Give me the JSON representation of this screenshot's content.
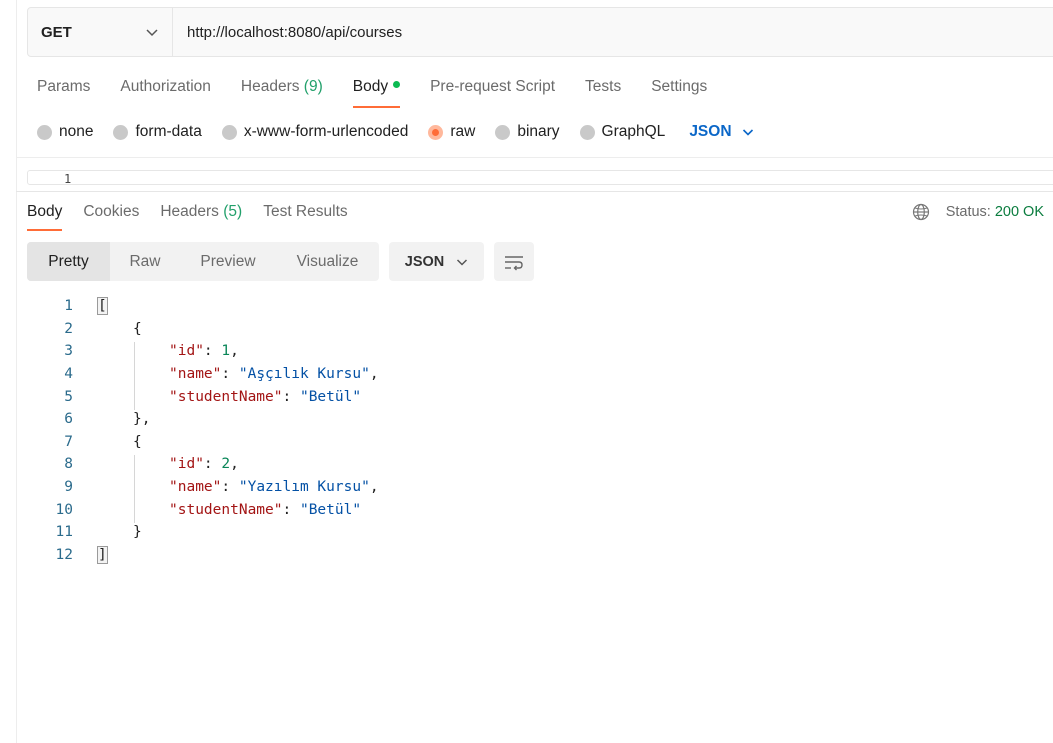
{
  "request": {
    "method": "GET",
    "url": "http://localhost:8080/api/courses"
  },
  "request_tabs": [
    {
      "label": "Params"
    },
    {
      "label": "Authorization"
    },
    {
      "label": "Headers",
      "count": "(9)"
    },
    {
      "label": "Body",
      "active": true
    },
    {
      "label": "Pre-request Script"
    },
    {
      "label": "Tests"
    },
    {
      "label": "Settings"
    }
  ],
  "body_types": [
    "none",
    "form-data",
    "x-www-form-urlencoded",
    "raw",
    "binary",
    "GraphQL"
  ],
  "body_selected": "raw",
  "body_language": "JSON",
  "request_editor": {
    "first_line": "1"
  },
  "response_tabs": [
    {
      "label": "Body"
    },
    {
      "label": "Cookies"
    },
    {
      "label": "Headers",
      "count": "(5)"
    },
    {
      "label": "Test Results"
    }
  ],
  "status": {
    "label": "Status:",
    "value": "200 OK"
  },
  "view_modes": [
    "Pretty",
    "Raw",
    "Preview",
    "Visualize"
  ],
  "format": "JSON",
  "response_lines": [
    {
      "n": "1",
      "t": "["
    },
    {
      "n": "2",
      "t": "{"
    },
    {
      "n": "3",
      "key": "\"id\"",
      "num": "1",
      "tail": ","
    },
    {
      "n": "4",
      "key": "\"name\"",
      "str": "\"Aşçılık Kursu\"",
      "tail": ","
    },
    {
      "n": "5",
      "key": "\"studentName\"",
      "str": "\"Betül\""
    },
    {
      "n": "6",
      "t": "},"
    },
    {
      "n": "7",
      "t": "{"
    },
    {
      "n": "8",
      "key": "\"id\"",
      "num": "2",
      "tail": ","
    },
    {
      "n": "9",
      "key": "\"name\"",
      "str": "\"Yazılım Kursu\"",
      "tail": ","
    },
    {
      "n": "10",
      "key": "\"studentName\"",
      "str": "\"Betül\""
    },
    {
      "n": "11",
      "t": "}"
    },
    {
      "n": "12",
      "t": "]"
    }
  ]
}
